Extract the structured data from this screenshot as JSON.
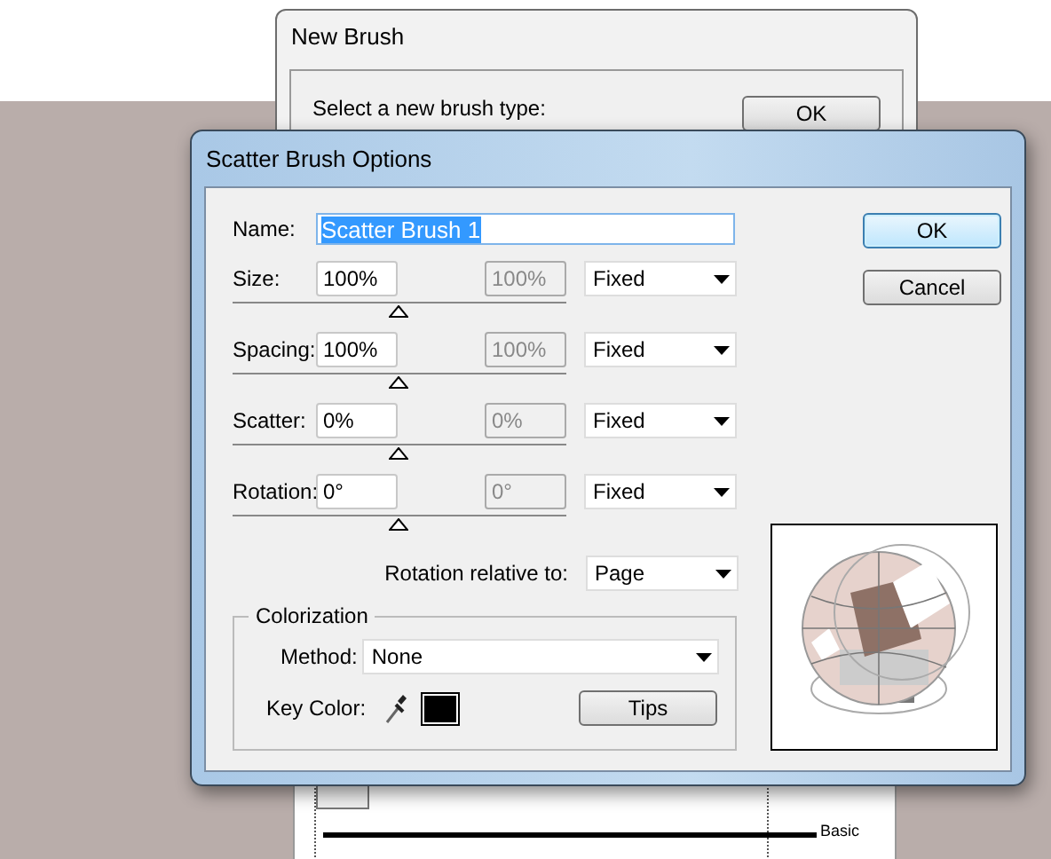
{
  "background_dialog": {
    "title": "New Brush",
    "prompt": "Select a new brush type:",
    "buttons": [
      {
        "label": "OK"
      }
    ]
  },
  "brush_library": {
    "items": [
      {
        "label": "Basic"
      }
    ]
  },
  "dialog": {
    "title": "Scatter Brush Options",
    "name": {
      "label": "Name:",
      "value": "Scatter Brush 1",
      "text_selected": true
    },
    "parameters": [
      {
        "label": "Size:",
        "value": "100%",
        "second_value": "100%",
        "second_disabled": true,
        "variation": "Fixed",
        "level": 0.5
      },
      {
        "label": "Spacing:",
        "value": "100%",
        "second_value": "100%",
        "second_disabled": true,
        "variation": "Fixed",
        "level": 0.5
      },
      {
        "label": "Scatter:",
        "value": "0%",
        "second_value": "0%",
        "second_disabled": true,
        "variation": "Fixed",
        "level": 0.5
      },
      {
        "label": "Rotation:",
        "value": "0°",
        "second_value": "0°",
        "second_disabled": true,
        "variation": "Fixed",
        "level": 0.5
      }
    ],
    "rotation_relative": {
      "label": "Rotation relative to:",
      "value": "Page"
    },
    "colorization": {
      "title": "Colorization",
      "method_label": "Method:",
      "method": "None",
      "key_color_label": "Key Color:",
      "key_swatch": {
        "color": "#000000"
      },
      "tips": "Tips"
    },
    "buttons": [
      {
        "label": "OK",
        "default": true
      },
      {
        "label": "Cancel",
        "default": false
      }
    ]
  }
}
